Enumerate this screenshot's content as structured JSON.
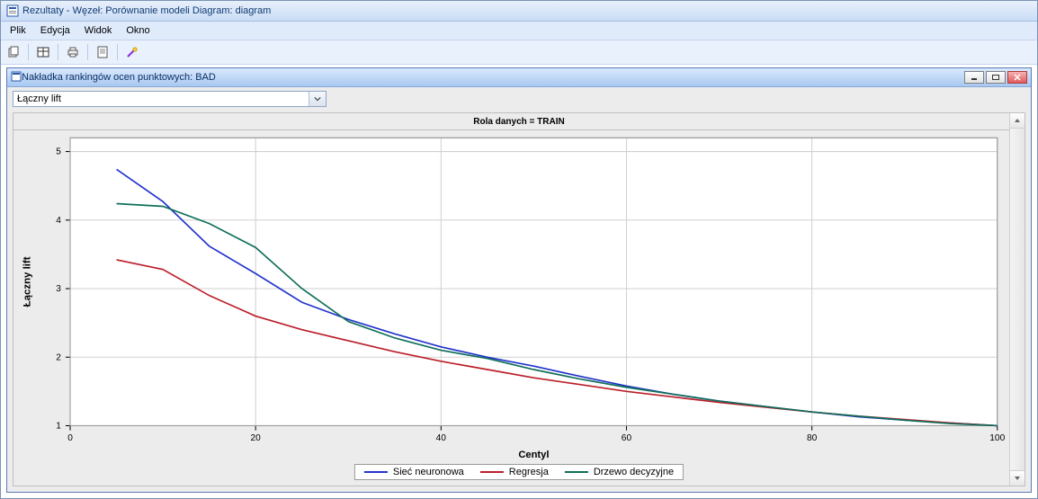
{
  "window": {
    "title": "Rezultaty - Węzeł: Porównanie modeli  Diagram: diagram"
  },
  "menu": {
    "items": [
      "Plik",
      "Edycja",
      "Widok",
      "Okno"
    ]
  },
  "inner": {
    "title": "Nakładka rankingów ocen punktowych: BAD"
  },
  "combo": {
    "value": "Łączny lift"
  },
  "chart_title_strip": "Rola danych = TRAIN",
  "axes": {
    "xlabel": "Centyl",
    "ylabel": "Łączny lift"
  },
  "chart_data": {
    "type": "line",
    "title": "Rola danych = TRAIN",
    "xlabel": "Centyl",
    "ylabel": "Łączny lift",
    "x_ticks": [
      0,
      20,
      40,
      60,
      80,
      100
    ],
    "y_ticks": [
      1,
      2,
      3,
      4,
      5
    ],
    "xlim": [
      0,
      100
    ],
    "ylim": [
      1,
      5.2
    ],
    "x": [
      5,
      10,
      15,
      20,
      25,
      30,
      35,
      40,
      45,
      50,
      55,
      60,
      65,
      70,
      75,
      80,
      85,
      90,
      95,
      100
    ],
    "series": [
      {
        "name": "Sieć neuronowa",
        "color": "#2233cc",
        "values": [
          4.74,
          4.27,
          3.62,
          3.22,
          2.8,
          2.55,
          2.34,
          2.15,
          2.0,
          1.87,
          1.72,
          1.58,
          1.46,
          1.36,
          1.28,
          1.2,
          1.13,
          1.08,
          1.04,
          1.0
        ]
      },
      {
        "name": "Regresja",
        "color": "#bb1f2a",
        "values": [
          3.42,
          3.28,
          2.9,
          2.6,
          2.4,
          2.24,
          2.08,
          1.94,
          1.82,
          1.7,
          1.6,
          1.5,
          1.42,
          1.34,
          1.27,
          1.2,
          1.14,
          1.09,
          1.04,
          1.0
        ]
      },
      {
        "name": "Drzewo decyzyjne",
        "color": "#0f6e5a",
        "values": [
          4.24,
          4.2,
          3.95,
          3.6,
          3.0,
          2.52,
          2.28,
          2.1,
          1.98,
          1.82,
          1.68,
          1.56,
          1.46,
          1.36,
          1.28,
          1.2,
          1.14,
          1.08,
          1.03,
          1.0
        ]
      }
    ],
    "legend_position": "bottom",
    "grid": true
  }
}
